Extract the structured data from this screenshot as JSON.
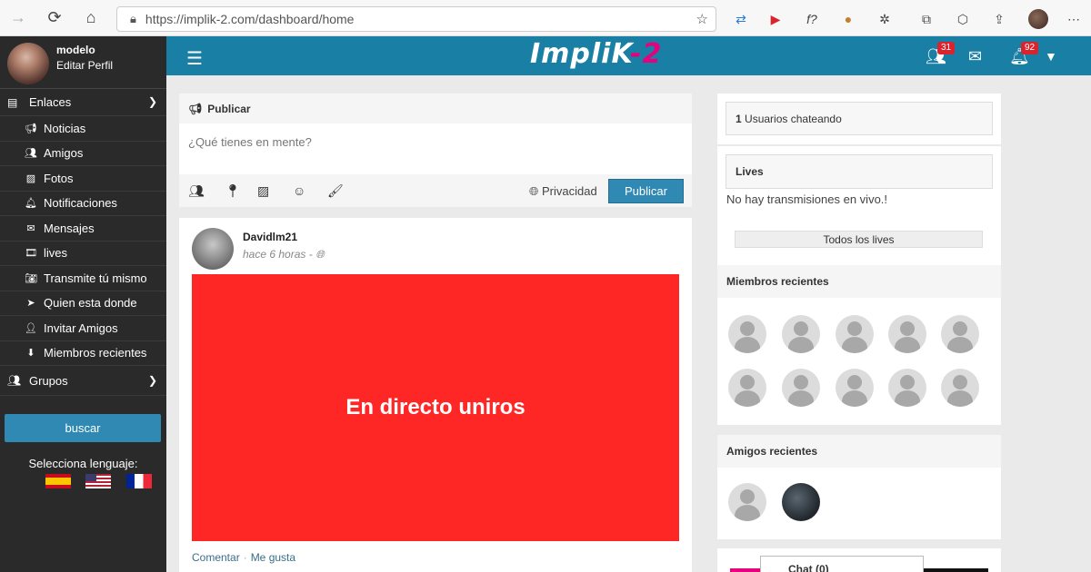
{
  "browser": {
    "url": "https://implik-2.com/dashboard/home"
  },
  "sidebar": {
    "user_name": "modelo",
    "edit_profile": "Editar Perfil",
    "links_section": "Enlaces",
    "items": [
      {
        "label": "Noticias",
        "icon": "megaphone-icon"
      },
      {
        "label": "Amigos",
        "icon": "users-icon"
      },
      {
        "label": "Fotos",
        "icon": "image-icon"
      },
      {
        "label": "Notificaciones",
        "icon": "bell-icon"
      },
      {
        "label": "Mensajes",
        "icon": "envelope-icon"
      },
      {
        "label": "lives",
        "icon": "film-icon"
      },
      {
        "label": "Transmite tú mismo",
        "icon": "camera-icon"
      },
      {
        "label": "Quien esta donde",
        "icon": "location-arrow-icon"
      },
      {
        "label": "Invitar Amigos",
        "icon": "user-plus-icon"
      },
      {
        "label": "Miembros recientes",
        "icon": "download-icon"
      }
    ],
    "groups_section": "Grupos",
    "search_button": "buscar",
    "language_label": "Selecciona lenguaje:"
  },
  "header": {
    "logo_part1": "ImpliK",
    "logo_part2": "-2",
    "friends_badge": "31",
    "notifications_badge": "92"
  },
  "publish": {
    "title": "Publicar",
    "placeholder": "¿Qué tienes en mente?",
    "privacy": "Privacidad",
    "submit": "Publicar"
  },
  "post": {
    "author": "Davidlm21",
    "time": "hace 6 horas -",
    "media_text": "En directo uniros",
    "comment": "Comentar",
    "like": "Me gusta"
  },
  "right": {
    "chat_count": "1",
    "chat_label": "Usuarios chateando",
    "lives_title": "Lives",
    "lives_empty": "No hay transmisiones en vivo.!",
    "all_lives": "Todos los lives",
    "recent_members_title": "Miembros recientes",
    "recent_friends_title": "Amigos recientes"
  },
  "chat": {
    "label": "Chat (0)"
  }
}
